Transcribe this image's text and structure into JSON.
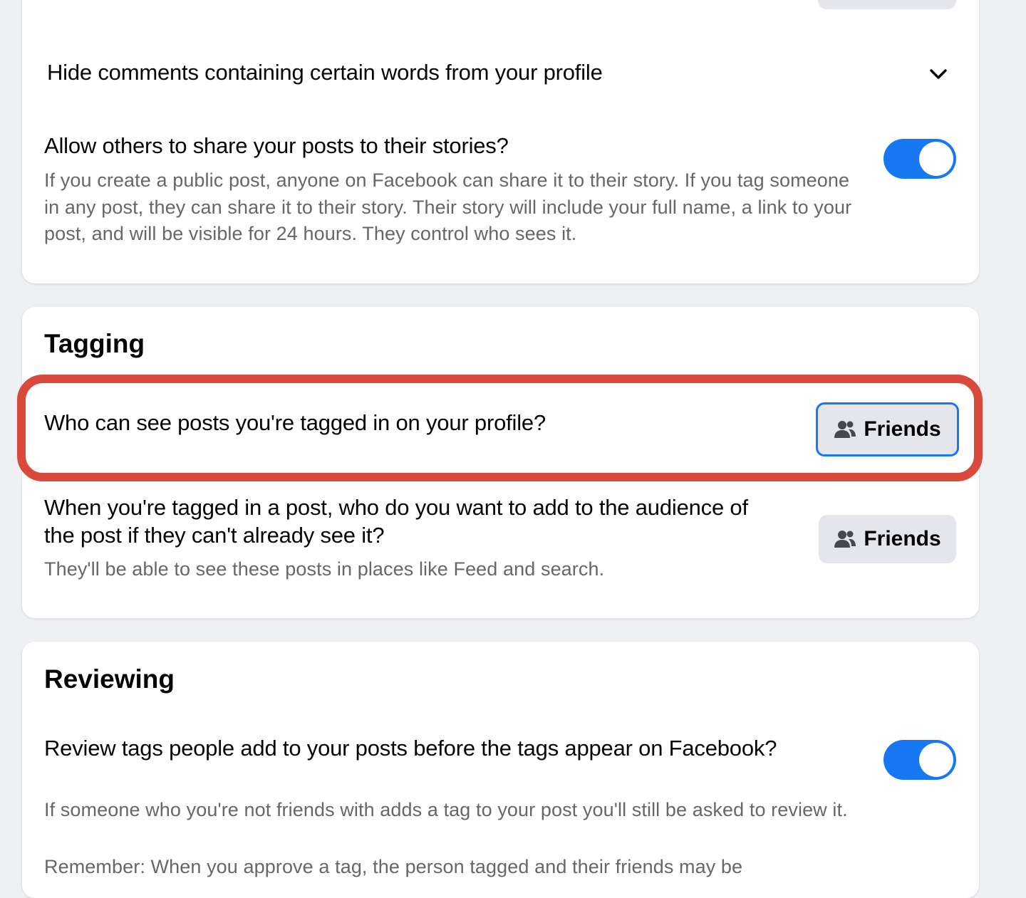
{
  "privacy_section": {
    "hide_comments_label": "Hide comments containing certain words from your profile",
    "share_to_stories": {
      "title": "Allow others to share your posts to their stories?",
      "description": "If you create a public post, anyone on Facebook can share it to their story. If you tag someone in any post, they can share it to their story. Their story will include your full name, a link to your post, and will be visible for 24 hours. They control who sees it.",
      "enabled": true
    }
  },
  "tagging": {
    "heading": "Tagging",
    "who_can_see": {
      "title": "Who can see posts you're tagged in on your profile?",
      "audience": "Friends",
      "audience_icon": "friends-icon"
    },
    "add_to_audience": {
      "title": "When you're tagged in a post, who do you want to add to the audience of the post if they can't already see it?",
      "description": "They'll be able to see these posts in places like Feed and search.",
      "audience": "Friends",
      "audience_icon": "friends-icon"
    }
  },
  "reviewing": {
    "heading": "Reviewing",
    "review_tags": {
      "title": "Review tags people add to your posts before the tags appear on Facebook?",
      "description": "If someone who you're not friends with adds a tag to your post you'll still be asked to review it.",
      "note": "Remember: When you approve a tag, the person tagged and their friends may be",
      "enabled": true
    }
  },
  "colors": {
    "accent": "#1877f2",
    "highlight": "#d94a3d",
    "background": "#eef0f3",
    "secondary_text": "#65676b"
  }
}
